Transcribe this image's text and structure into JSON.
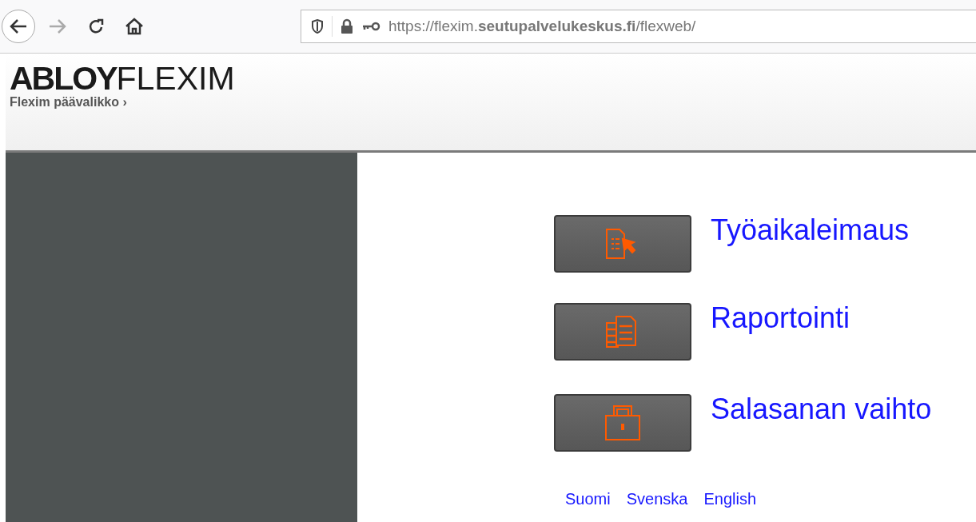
{
  "browser": {
    "url": "https://flexim.**seutupalvelukeskus.fi**/flexweb/"
  },
  "header": {
    "logo_bold": "ABLOY",
    "logo_light": "FLEXIM",
    "breadcrumb": "Flexim päävalikko ›"
  },
  "menu": [
    {
      "kind": "clock",
      "label": "Työaikaleimaus"
    },
    {
      "kind": "report",
      "label": "Raportointi"
    },
    {
      "kind": "lock",
      "label": "Salasanan vaihto"
    }
  ],
  "languages": [
    "Suomi",
    "Svenska",
    "English"
  ]
}
